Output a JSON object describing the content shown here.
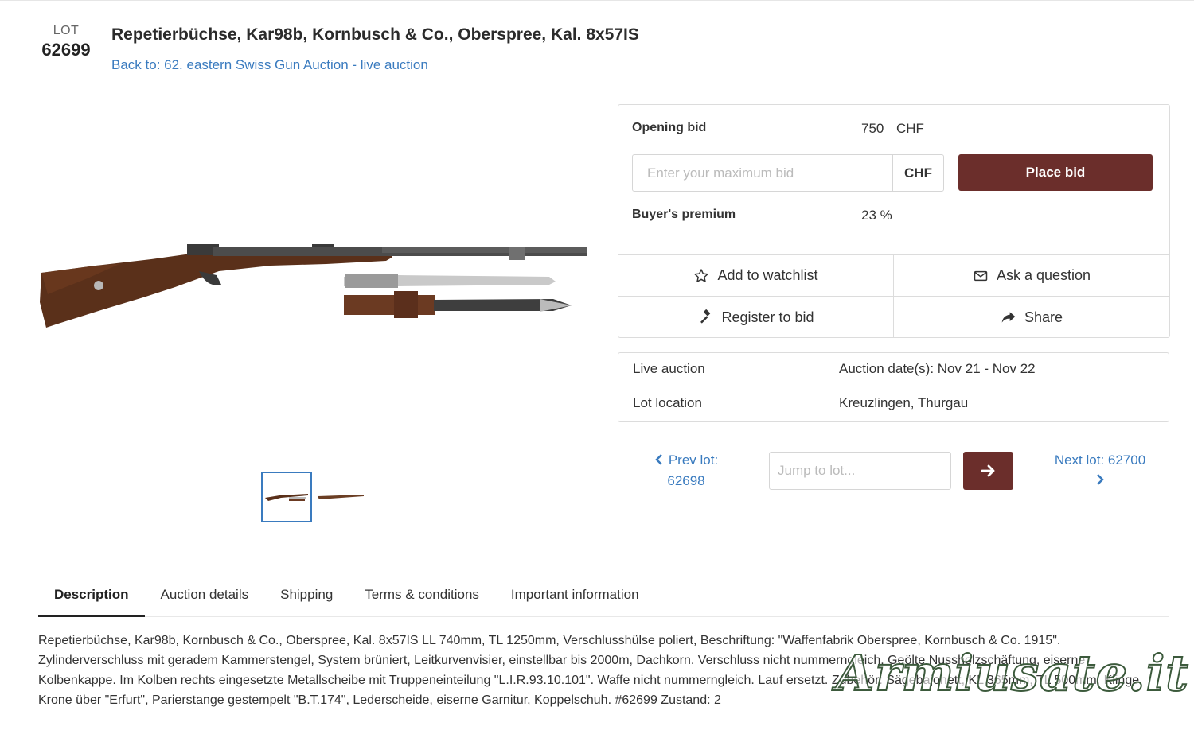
{
  "lot": {
    "label": "LOT",
    "number": "62699",
    "title": "Repetierbüchse, Kar98b, Kornbusch & Co., Oberspree, Kal. 8x57IS",
    "back_link": "Back to: 62. eastern Swiss Gun Auction - live auction"
  },
  "bidding": {
    "opening_bid_label": "Opening bid",
    "opening_bid_value": "750",
    "opening_bid_currency": "CHF",
    "bid_placeholder": "Enter your maximum bid",
    "bid_currency": "CHF",
    "place_bid_label": "Place bid",
    "buyers_premium_label": "Buyer's premium",
    "buyers_premium_value": "23 %"
  },
  "actions": {
    "watchlist": "Add to watchlist",
    "ask_question": "Ask a question",
    "register": "Register to bid",
    "share": "Share"
  },
  "auction_info": {
    "type_label": "Live auction",
    "dates": "Auction date(s): Nov 21 - Nov 22",
    "location_label": "Lot location",
    "location": "Kreuzlingen, Thurgau"
  },
  "navigation": {
    "prev_label": "Prev lot:",
    "prev_number": "62698",
    "jump_placeholder": "Jump to lot...",
    "next_label": "Next lot: 62700"
  },
  "tabs": [
    "Description",
    "Auction details",
    "Shipping",
    "Terms & conditions",
    "Important information"
  ],
  "description": "Repetierbüchse, Kar98b, Kornbusch & Co., Oberspree, Kal. 8x57IS LL 740mm, TL 1250mm, Verschlusshülse poliert, Beschriftung: \"Waffenfabrik Oberspree, Kornbusch & Co. 1915\". Zylinderverschluss mit geradem Kammerstengel, System brüniert, Leitkurvenvisier, einstellbar bis 2000m, Dachkorn. Verschluss nicht nummerngleich. Geölte Nussholzschäftung, eiserne Kolbenkappe. Im Kolben rechts eingesetzte Metallscheibe mit Truppeneinteilung \"L.I.R.93.10.101\". Waffe nicht nummerngleich. Lauf ersetzt. Zubehör: Sägebajonett, KL 365mm, TL 500mm, Klinge Krone über \"Erfurt\", Parierstange gestempelt \"B.T.174\", Lederscheide, eiserne Garnitur, Koppelschuh. #62699 Zustand: 2",
  "watermark": "Armiusate.it",
  "colors": {
    "accent": "#6b2e2b",
    "link": "#3a7bbf"
  }
}
